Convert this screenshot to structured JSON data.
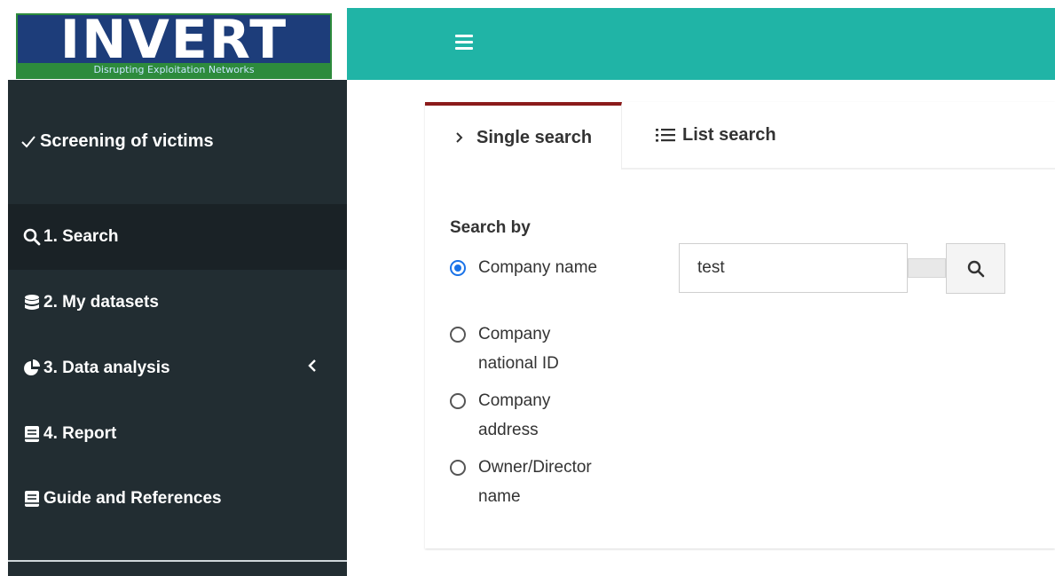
{
  "brand": {
    "logo_text": "INVERT",
    "tagline": "Disrupting Exploitation Networks",
    "topbar_color": "#20b4a6"
  },
  "sidebar": {
    "header": {
      "label": "Screening of victims",
      "icon": "check-icon"
    },
    "items": [
      {
        "label": "1. Search",
        "icon": "search-icon",
        "active": true
      },
      {
        "label": "2. My datasets",
        "icon": "database-icon"
      },
      {
        "label": "3. Data analysis",
        "icon": "pie-chart-icon",
        "expandable": true,
        "chevron": "chevron-left-icon"
      },
      {
        "label": "4. Report",
        "icon": "book-icon"
      },
      {
        "label": "Guide and References",
        "icon": "book-icon"
      }
    ]
  },
  "tabs": [
    {
      "label": "Single search",
      "icon": "chevron-right-icon",
      "active": true
    },
    {
      "label": "List search",
      "icon": "list-icon"
    }
  ],
  "search_form": {
    "heading": "Search by",
    "options": [
      {
        "label": "Company name",
        "checked": true
      },
      {
        "label": "Company national ID",
        "checked": false
      },
      {
        "label": "Company address",
        "checked": false
      },
      {
        "label": "Owner/Director name",
        "checked": false
      }
    ],
    "query": "test",
    "button_icon": "search-icon"
  },
  "colors": {
    "sidebar_bg": "#222d32",
    "active_tab_border": "#8b1a1a",
    "radio_checked": "#1a73e8"
  }
}
